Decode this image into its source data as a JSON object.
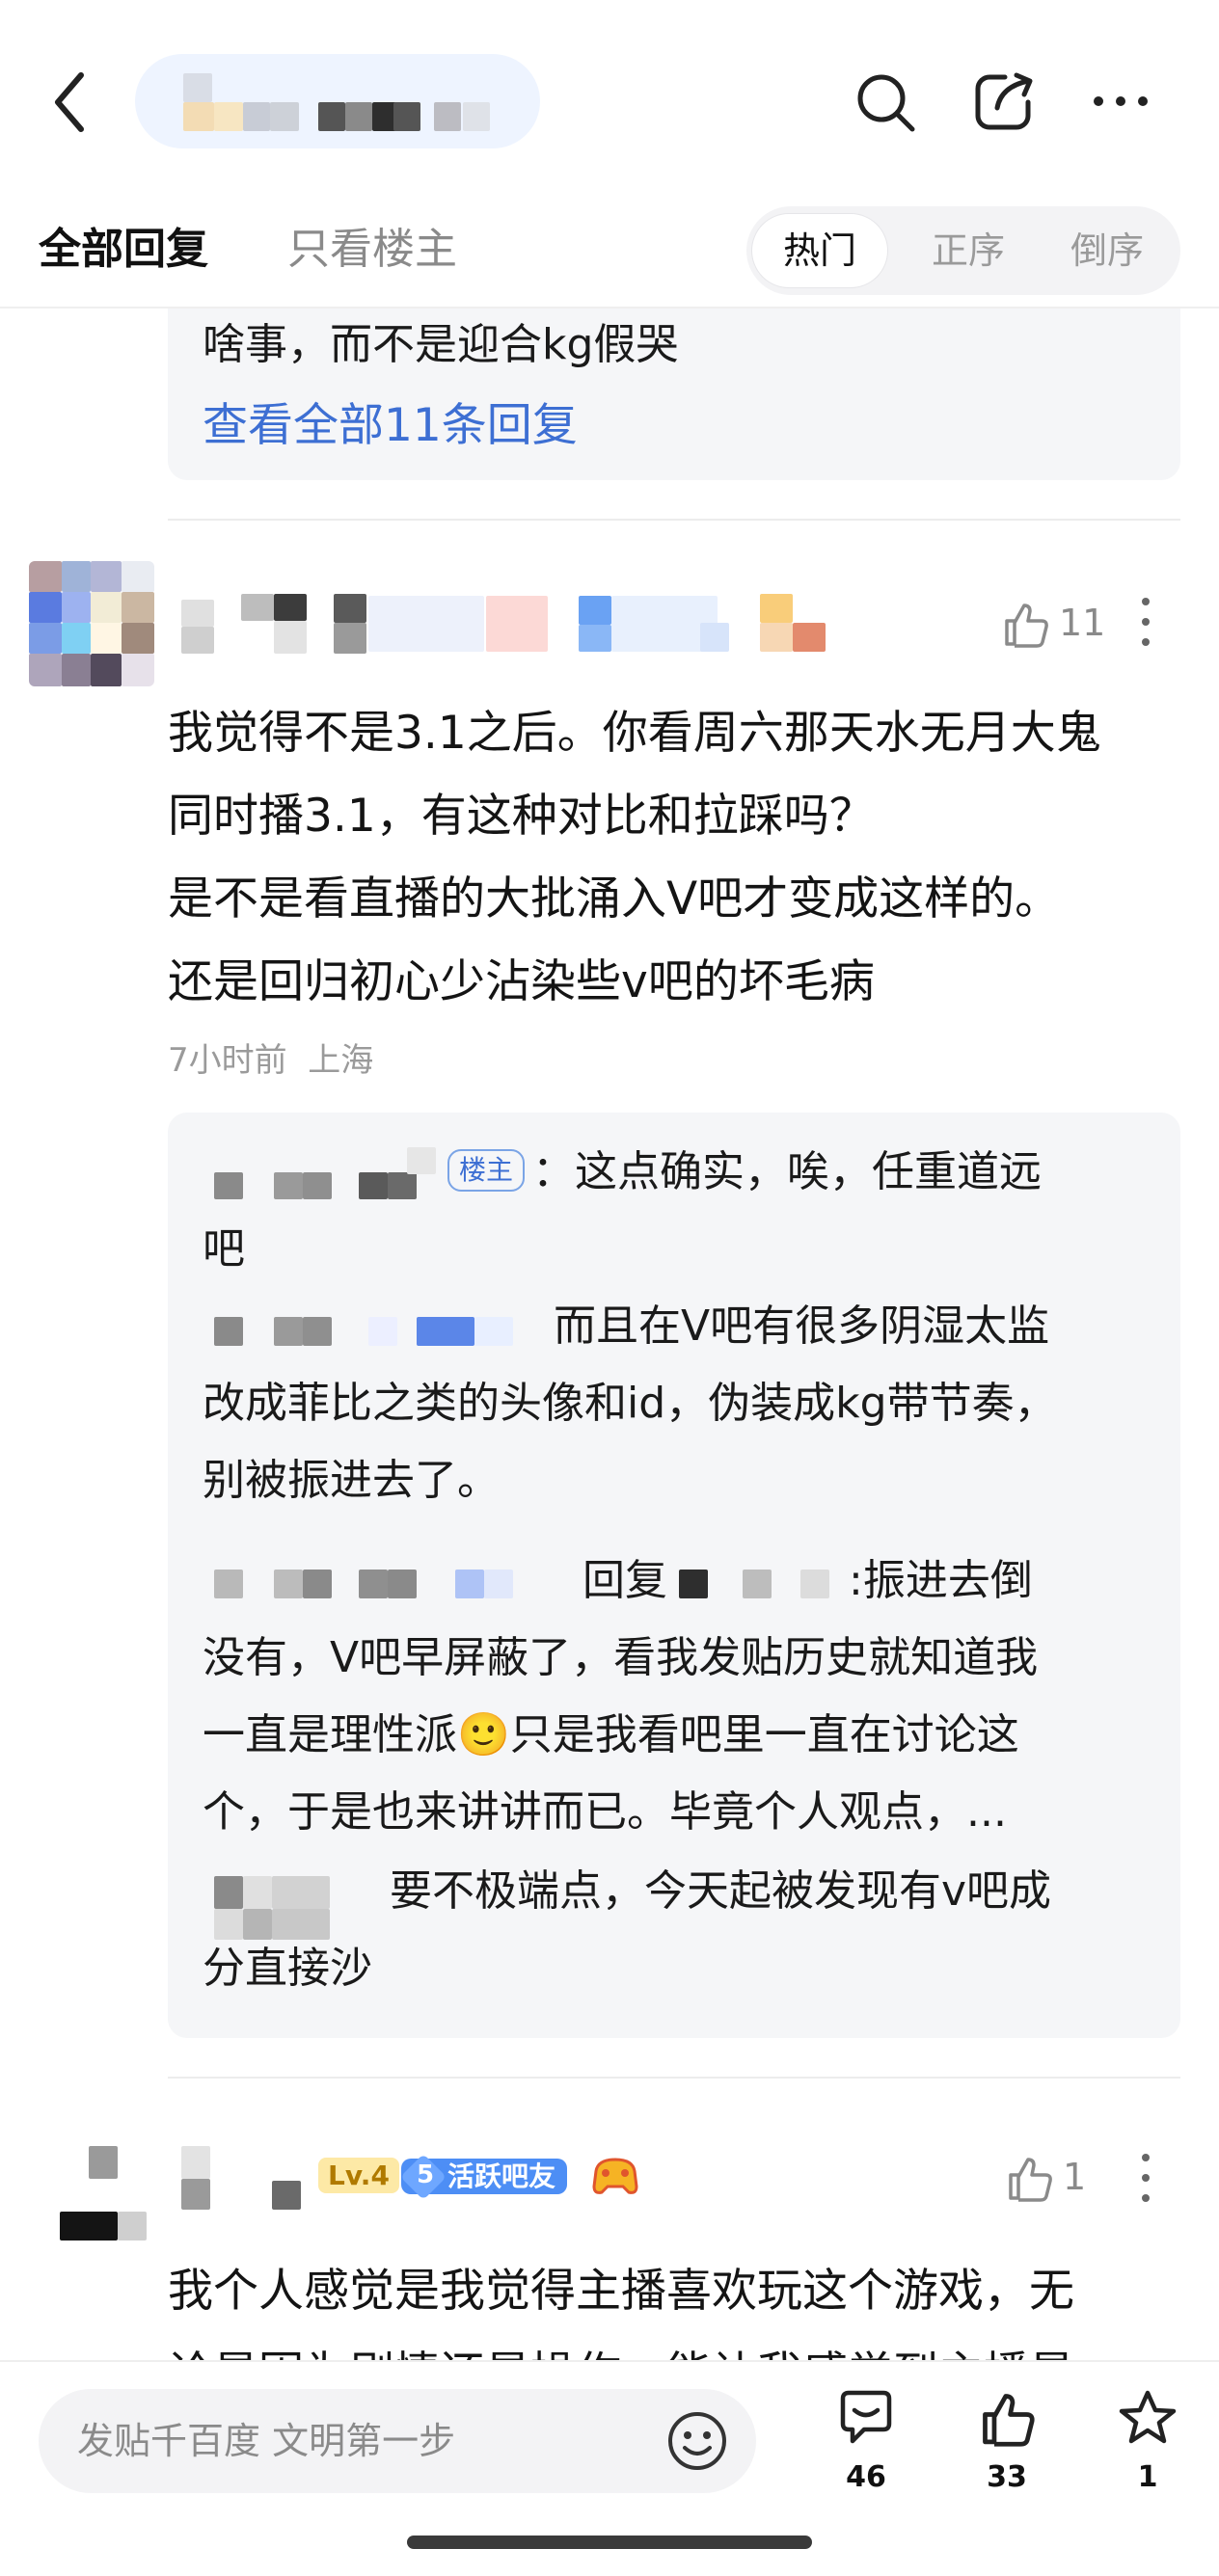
{
  "tabs": {
    "all_replies": "全部回复",
    "owner_only": "只看楼主"
  },
  "sort": {
    "hot": "热门",
    "ascending": "正序",
    "descending": "倒序"
  },
  "prev_reply": {
    "text_tail": "啥事，而不是迎合kg假哭",
    "view_all": "查看全部11条回复"
  },
  "post1": {
    "like_count": "11",
    "body": [
      "我觉得不是3.1之后。你看周六那天水无月大鬼",
      "同时播3.1，有这种对比和拉踩吗？",
      "是不是看直播的大批涌入V吧才变成这样的。",
      "还是回归初心少沾染些v吧的坏毛病"
    ],
    "meta": "7小时前  上海",
    "replies": {
      "r1_badge": "楼主",
      "r1_line1": "：这点确实，唉，任重道远",
      "r1_line2": "吧",
      "r2_line1": "而且在V吧有很多阴湿太监",
      "r2_line2": "改成菲比之类的头像和id，伪装成kg带节奏，",
      "r2_line3": "别被振进去了。",
      "r3_reply": "回复",
      "r3_line1": ":振进去倒",
      "r3_line2": "没有，V吧早屏蔽了，看我发贴历史就知道我",
      "r3_line3a": "一直是理性派",
      "r3_emoji": "🙂",
      "r3_line3b": "只是我看吧里一直在讨论这",
      "r3_line4": "个，于是也来讲讲而已。毕竟个人观点，...",
      "r4_line1": "要不极端点，今天起被发现有v吧成",
      "r4_line2": "分直接沙"
    }
  },
  "post2": {
    "level": "Lv.4",
    "badge_number": "5",
    "badge_text": "活跃吧友",
    "like_count": "1",
    "body_line1": "我个人感觉是我觉得主播喜欢玩这个游戏，无",
    "body_line2": "论是因为剧情还是操作，能让我感觉到主播是"
  },
  "bottom": {
    "input_placeholder": "发贴千百度 文明第一步",
    "comments": "46",
    "likes": "33",
    "favorites": "1"
  },
  "colors": {
    "accent": "#3d6fd3",
    "reply_bg": "#f5f6f8",
    "badge_blue": "#4d8ef5"
  }
}
